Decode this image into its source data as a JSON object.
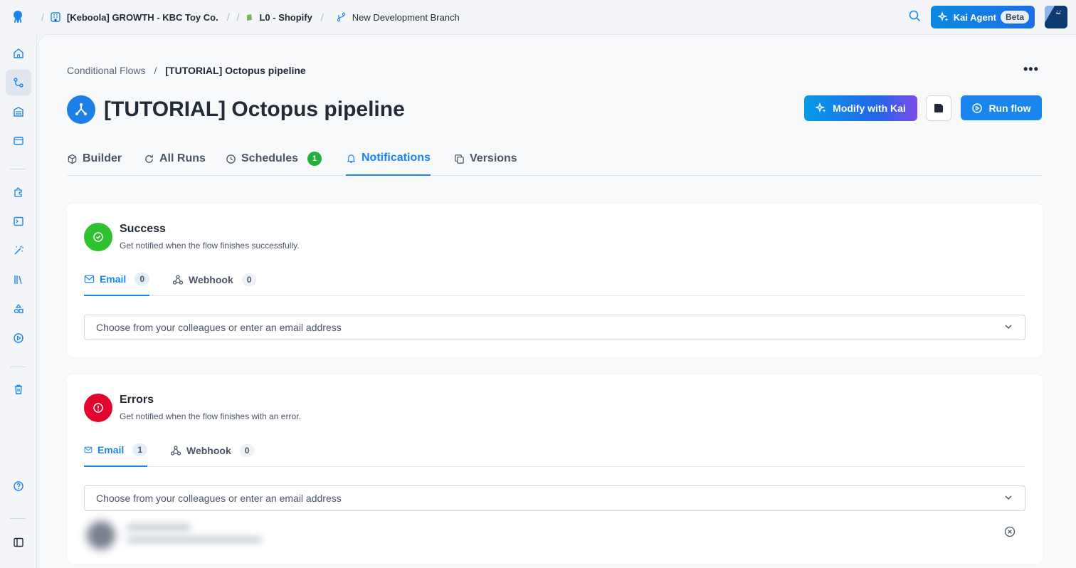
{
  "topbar": {
    "project": "[Keboola] GROWTH - KBC Toy Co.",
    "config": "L0 - Shopify",
    "branch": "New Development Branch",
    "agent_label": "Kai Agent",
    "agent_badge": "Beta"
  },
  "breadcrumb": {
    "parent": "Conditional Flows",
    "separator": "/",
    "current": "[TUTORIAL] Octopus pipeline"
  },
  "page": {
    "title": "[TUTORIAL] Octopus pipeline",
    "modify_label": "Modify with Kai",
    "run_label": "Run flow",
    "more_label": "•••"
  },
  "tabs": [
    {
      "label": "Builder",
      "icon": "cube-icon"
    },
    {
      "label": "All Runs",
      "icon": "refresh-icon"
    },
    {
      "label": "Schedules",
      "icon": "clock-icon",
      "count": "1"
    },
    {
      "label": "Notifications",
      "icon": "bell-icon",
      "active": true
    },
    {
      "label": "Versions",
      "icon": "copy-icon"
    }
  ],
  "success_card": {
    "title": "Success",
    "subtitle": "Get notified when the flow finishes successfully.",
    "email_tab": "Email",
    "email_count": "0",
    "webhook_tab": "Webhook",
    "webhook_count": "0",
    "placeholder": "Choose from your colleagues or enter an email address",
    "color": "#2fc12f"
  },
  "errors_card": {
    "title": "Errors",
    "subtitle": "Get notified when the flow finishes with an error.",
    "email_tab": "Email",
    "email_count": "1",
    "webhook_tab": "Webhook",
    "webhook_count": "0",
    "placeholder": "Choose from your colleagues or enter an email address",
    "color": "#e3062c"
  },
  "colors": {
    "accent": "#1b85ee",
    "background": "#f3f5f8"
  }
}
